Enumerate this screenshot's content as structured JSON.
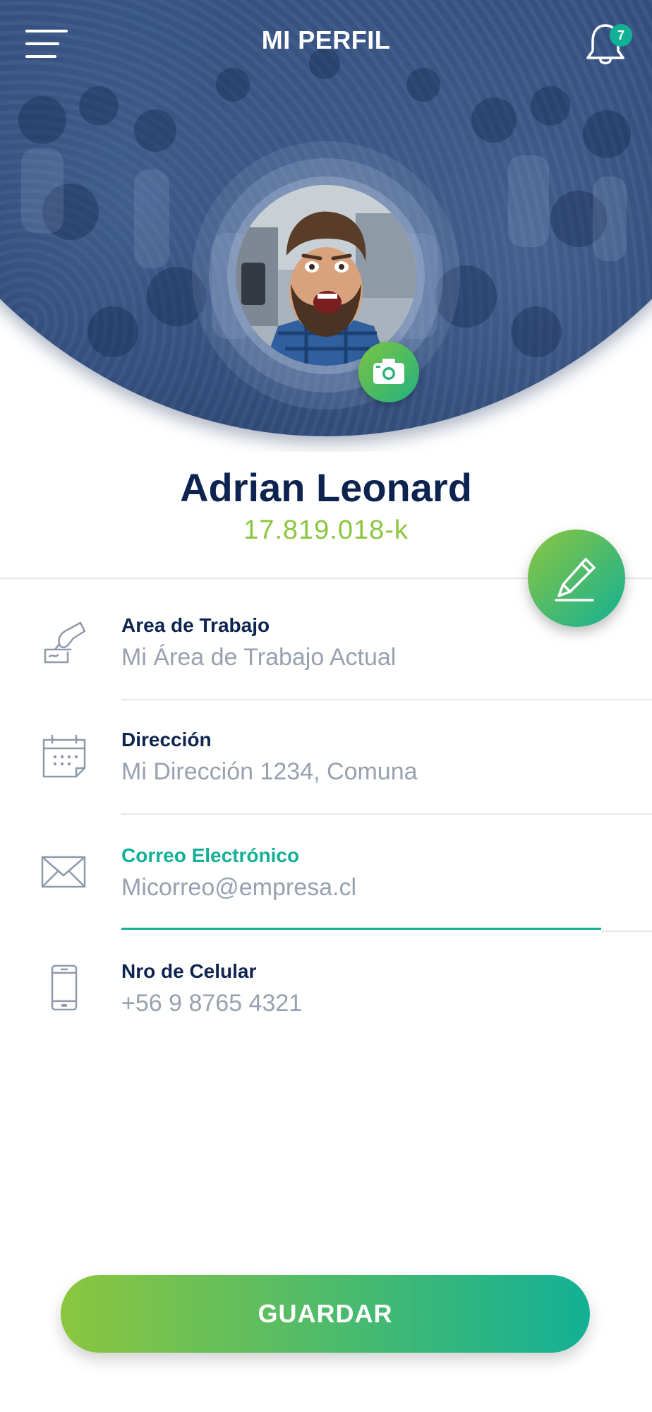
{
  "header": {
    "title": "MI PERFIL",
    "menu_icon": "hamburger-menu-icon",
    "notification_icon": "bell-icon",
    "notification_count": "7"
  },
  "profile": {
    "name": "Adrian Leonard",
    "rut": "17.819.018-k",
    "camera_icon": "camera-icon",
    "edit_icon": "pencil-icon"
  },
  "fields": [
    {
      "label": "Area de Trabajo",
      "value": "Mi Área de Trabajo Actual",
      "icon": "signature-hand-icon"
    },
    {
      "label": "Dirección",
      "value": "Mi Dirección 1234, Comuna",
      "icon": "calendar-icon"
    },
    {
      "label": "Correo Electrónico",
      "value": "Micorreo@empresa.cl",
      "icon": "envelope-icon"
    },
    {
      "label": "Nro de Celular",
      "value": "+56 9 8765 4321",
      "icon": "mobile-phone-icon"
    }
  ],
  "actions": {
    "save_label": "GUARDAR"
  },
  "colors": {
    "navy": "#0e2450",
    "green": "#8cc63f",
    "teal": "#12b095",
    "muted_text": "#97a1b0"
  }
}
